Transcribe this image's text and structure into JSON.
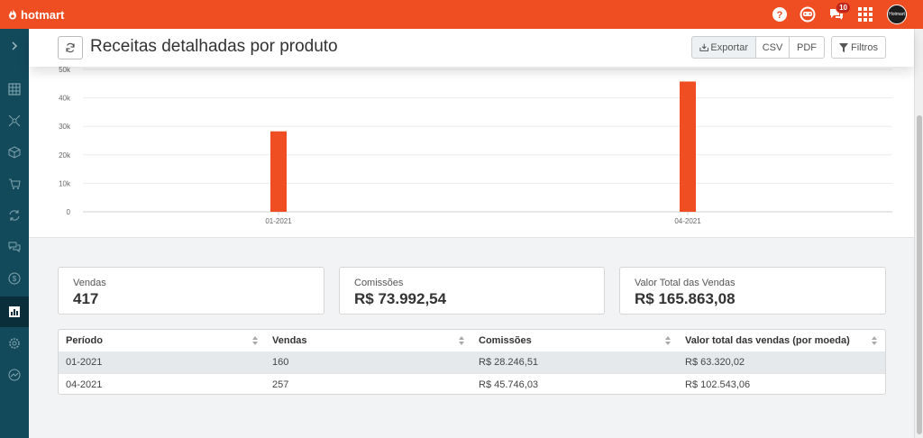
{
  "app": {
    "brand": "hotmart",
    "notification_count": "10",
    "avatar_text": "Hotmart"
  },
  "colors": {
    "brand": "#ef4e23",
    "sidebar": "#134a5b",
    "bar": "#ef4e23"
  },
  "header": {
    "title": "Receitas detalhadas por produto",
    "export_label": "Exportar",
    "csv_label": "CSV",
    "pdf_label": "PDF",
    "filters_label": "Filtros"
  },
  "sidebar": {
    "items": [
      {
        "icon": "chevron-right-icon"
      },
      {
        "icon": "dashboard-grid-icon"
      },
      {
        "icon": "affiliates-network-icon"
      },
      {
        "icon": "product-box-icon"
      },
      {
        "icon": "shopping-cart-icon"
      },
      {
        "icon": "recurrence-icon"
      },
      {
        "icon": "chat-icon"
      },
      {
        "icon": "dollar-coin-icon"
      },
      {
        "icon": "reports-chart-icon"
      },
      {
        "icon": "settings-gear-icon"
      },
      {
        "icon": "integrations-icon"
      }
    ]
  },
  "chart_data": {
    "type": "bar",
    "categories": [
      "01-2021",
      "04-2021"
    ],
    "values": [
      28246.51,
      45746.03
    ],
    "yticks": [
      "0",
      "10k",
      "20k",
      "30k",
      "40k",
      "50k"
    ],
    "ylim": [
      0,
      50000
    ],
    "grid": true
  },
  "stats": {
    "sales_label": "Vendas",
    "sales_value": "417",
    "commissions_label": "Comissões",
    "commissions_value": "R$ 73.992,54",
    "total_label": "Valor Total das Vendas",
    "total_value": "R$ 165.863,08"
  },
  "table": {
    "headers": [
      "Período",
      "Vendas",
      "Comissões",
      "Valor total das vendas (por moeda)"
    ],
    "rows": [
      [
        "01-2021",
        "160",
        "R$ 28.246,51",
        "R$ 63.320,02"
      ],
      [
        "04-2021",
        "257",
        "R$ 45.746,03",
        "R$ 102.543,06"
      ]
    ]
  }
}
